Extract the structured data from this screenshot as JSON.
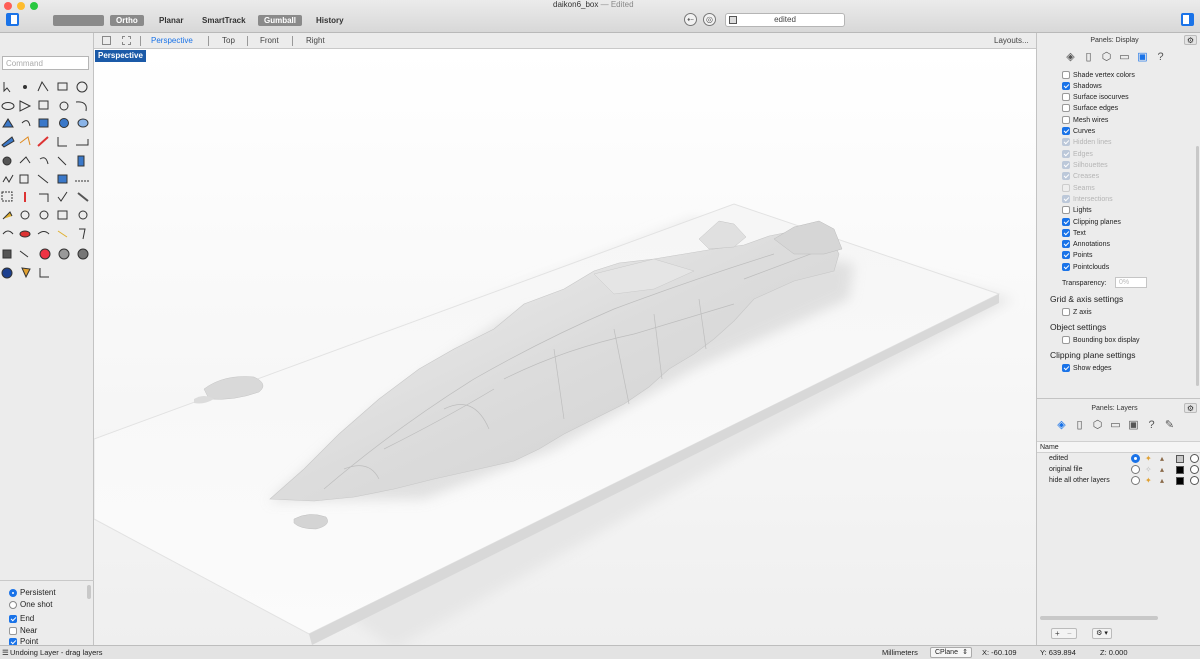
{
  "colors": {
    "accent": "#1a73e8",
    "viewport_label_bg": "#1b5aa8",
    "light_close": "#fe5f57",
    "light_min": "#febc2e",
    "light_max": "#28c840"
  },
  "window": {
    "title": "daikon6_box",
    "title_suffix": "— Edited",
    "status_field": "edited"
  },
  "toolbar": {
    "buttons": [
      {
        "label": "Ortho",
        "active": true
      },
      {
        "label": "Planar",
        "active": false
      },
      {
        "label": "SmartTrack",
        "active": false
      },
      {
        "label": "Gumball",
        "active": true
      },
      {
        "label": "History",
        "active": false
      }
    ]
  },
  "viewport_tabs": {
    "tabs": [
      "Perspective",
      "Top",
      "Front",
      "Right"
    ],
    "active": "Perspective",
    "layouts_label": "Layouts..."
  },
  "viewport": {
    "label": "Perspective"
  },
  "command": {
    "placeholder": "Command"
  },
  "osnap": {
    "modes": [
      {
        "label": "Persistent",
        "selected": true
      },
      {
        "label": "One shot",
        "selected": false
      }
    ],
    "snaps": [
      {
        "label": "End",
        "checked": true
      },
      {
        "label": "Near",
        "checked": false
      },
      {
        "label": "Point",
        "checked": true
      }
    ]
  },
  "display_panel": {
    "title": "Panels: Display",
    "tab_icons": [
      "layers-icon",
      "document-icon",
      "cube-icon",
      "page-icon",
      "display-icon",
      "help-icon"
    ],
    "active_icon": "display-icon",
    "options": [
      {
        "label": "Shade vertex colors",
        "checked": false,
        "enabled": true
      },
      {
        "label": "Shadows",
        "checked": true,
        "enabled": true
      },
      {
        "label": "Surface isocurves",
        "checked": false,
        "enabled": true
      },
      {
        "label": "Surface edges",
        "checked": false,
        "enabled": true
      },
      {
        "label": "Mesh wires",
        "checked": false,
        "enabled": true
      },
      {
        "label": "Curves",
        "checked": true,
        "enabled": true
      },
      {
        "label": "Hidden lines",
        "checked": true,
        "enabled": false
      },
      {
        "label": "Edges",
        "checked": true,
        "enabled": false
      },
      {
        "label": "Silhouettes",
        "checked": true,
        "enabled": false
      },
      {
        "label": "Creases",
        "checked": true,
        "enabled": false
      },
      {
        "label": "Seams",
        "checked": false,
        "enabled": false
      },
      {
        "label": "Intersections",
        "checked": true,
        "enabled": false
      },
      {
        "label": "Lights",
        "checked": false,
        "enabled": true
      },
      {
        "label": "Clipping planes",
        "checked": true,
        "enabled": true
      },
      {
        "label": "Text",
        "checked": true,
        "enabled": true
      },
      {
        "label": "Annotations",
        "checked": true,
        "enabled": true
      },
      {
        "label": "Points",
        "checked": true,
        "enabled": true
      },
      {
        "label": "Pointclouds",
        "checked": true,
        "enabled": true
      }
    ],
    "transparency_label": "Transparency:",
    "transparency_value": "0%",
    "sections": [
      {
        "title": "Grid & axis settings",
        "options": [
          {
            "label": "Z axis",
            "checked": false
          }
        ]
      },
      {
        "title": "Object settings",
        "options": [
          {
            "label": "Bounding box display",
            "checked": false
          }
        ]
      },
      {
        "title": "Clipping plane settings",
        "options": [
          {
            "label": "Show edges",
            "checked": true
          }
        ]
      }
    ]
  },
  "layers_panel": {
    "title": "Panels: Layers",
    "column_name": "Name",
    "active_icon": "layers-icon",
    "layers": [
      {
        "name": "edited",
        "current": true,
        "color": "#c8c8c8"
      },
      {
        "name": "original file",
        "current": false,
        "color": "#000000"
      },
      {
        "name": "hide all other layers",
        "current": false,
        "color": "#000000"
      }
    ],
    "add_label": "+",
    "remove_label": "−"
  },
  "statusbar": {
    "message": "Undoing Layer - drag layers",
    "units": "Millimeters",
    "cplane": "CPlane",
    "x": "X: -60.109",
    "y": "Y: 639.894",
    "z": "Z: 0.000"
  }
}
